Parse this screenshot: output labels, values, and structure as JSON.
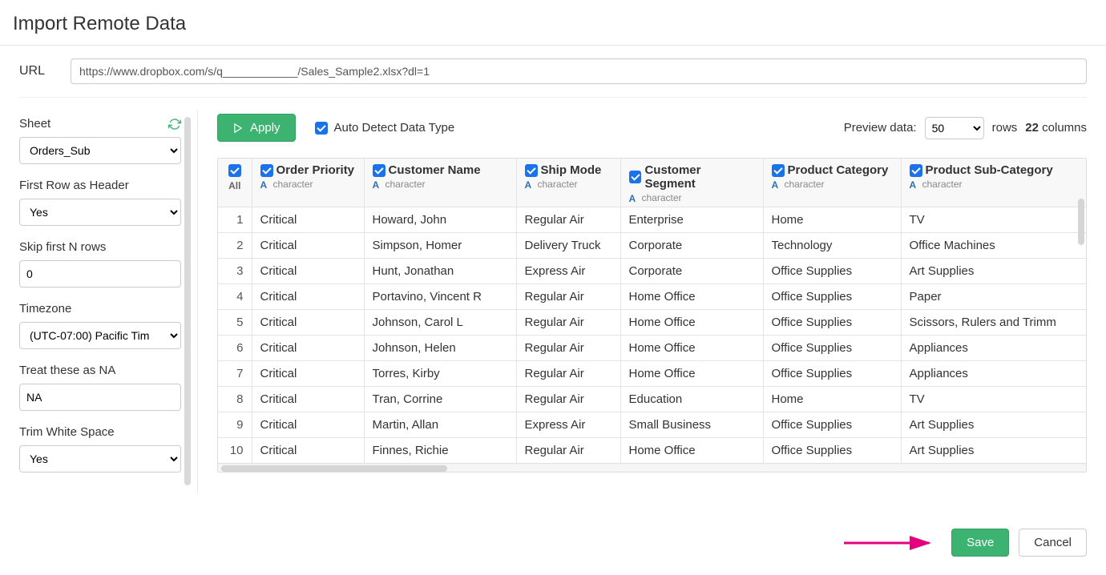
{
  "title": "Import Remote Data",
  "url": {
    "label": "URL",
    "value": "https://www.dropbox.com/s/q____________/Sales_Sample2.xlsx?dl=1"
  },
  "sidebar": {
    "sheet": {
      "label": "Sheet",
      "value": "Orders_Sub"
    },
    "first_row_header": {
      "label": "First Row as Header",
      "value": "Yes"
    },
    "skip_rows": {
      "label": "Skip first N rows",
      "value": "0"
    },
    "timezone": {
      "label": "Timezone",
      "value": "(UTC-07:00) Pacific Tim"
    },
    "treat_na": {
      "label": "Treat these as NA",
      "value": "NA"
    },
    "trim_ws": {
      "label": "Trim White Space",
      "value": "Yes"
    }
  },
  "controls": {
    "apply_label": "Apply",
    "auto_detect_label": "Auto Detect Data Type",
    "preview_label": "Preview data:",
    "preview_value": "50",
    "rows_label": "rows",
    "columns_count": "22",
    "columns_label": "columns"
  },
  "table": {
    "type_label": "character",
    "all_label": "All",
    "columns": [
      "Order Priority",
      "Customer Name",
      "Ship Mode",
      "Customer Segment",
      "Product Category",
      "Product Sub-Category"
    ],
    "rows": [
      {
        "n": "1",
        "c": [
          "Critical",
          "Howard, John",
          "Regular Air",
          "Enterprise",
          "Home",
          "TV"
        ]
      },
      {
        "n": "2",
        "c": [
          "Critical",
          "Simpson, Homer",
          "Delivery Truck",
          "Corporate",
          "Technology",
          "Office Machines"
        ]
      },
      {
        "n": "3",
        "c": [
          "Critical",
          "Hunt, Jonathan",
          "Express Air",
          "Corporate",
          "Office Supplies",
          "Art Supplies"
        ]
      },
      {
        "n": "4",
        "c": [
          "Critical",
          "Portavino, Vincent R",
          "Regular Air",
          "Home Office",
          "Office Supplies",
          "Paper"
        ]
      },
      {
        "n": "5",
        "c": [
          "Critical",
          "Johnson, Carol L",
          "Regular Air",
          "Home Office",
          "Office Supplies",
          "Scissors, Rulers and Trimm"
        ]
      },
      {
        "n": "6",
        "c": [
          "Critical",
          "Johnson, Helen",
          "Regular Air",
          "Home Office",
          "Office Supplies",
          "Appliances"
        ]
      },
      {
        "n": "7",
        "c": [
          "Critical",
          "Torres, Kirby",
          "Regular Air",
          "Home Office",
          "Office Supplies",
          "Appliances"
        ]
      },
      {
        "n": "8",
        "c": [
          "Critical",
          "Tran, Corrine",
          "Regular Air",
          "Education",
          "Home",
          "TV"
        ]
      },
      {
        "n": "9",
        "c": [
          "Critical",
          "Martin, Allan",
          "Express Air",
          "Small Business",
          "Office Supplies",
          "Art Supplies"
        ]
      },
      {
        "n": "10",
        "c": [
          "Critical",
          "Finnes, Richie",
          "Regular Air",
          "Home Office",
          "Office Supplies",
          "Art Supplies"
        ]
      }
    ]
  },
  "footer": {
    "save_label": "Save",
    "cancel_label": "Cancel"
  }
}
